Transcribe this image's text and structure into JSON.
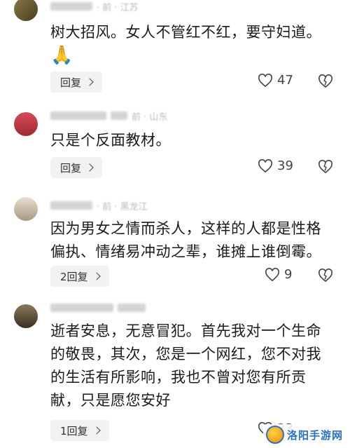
{
  "comments": [
    {
      "meta": "· 前 · 江苏",
      "text_lines": [
        "树大招风。女人不管红不红，要守妇道。"
      ],
      "emoji": "🙏",
      "reply_label": "回复",
      "likes": "47",
      "avatar_color": "#7a6a3a"
    },
    {
      "meta": "前 · 山东",
      "text_lines": [
        "只是个反面教材。"
      ],
      "reply_label": "回复",
      "likes": "39",
      "avatar_color": "#c0404a"
    },
    {
      "meta": "· 前 · 黑龙江",
      "text_lines": [
        "因为男女之情而杀人，这样的人都是性格",
        "偏执、情绪易冲动之辈，谁摊上谁倒霉。"
      ],
      "reply_label": "2回复",
      "likes": "9",
      "avatar_color": "#b8a890"
    },
    {
      "meta": "",
      "text_lines": [
        "逝者安息，无意冒犯。首先我对一个生命",
        "的敬畏，其次，您是一个网红，您不对我",
        "的生活有所影响，我也不曾对您有所贡",
        "献，只是愿您安好"
      ],
      "reply_label": "1回复",
      "likes": "23",
      "avatar_color": "#6a5a40"
    }
  ],
  "watermark": {
    "text": "洛阳手游网"
  }
}
